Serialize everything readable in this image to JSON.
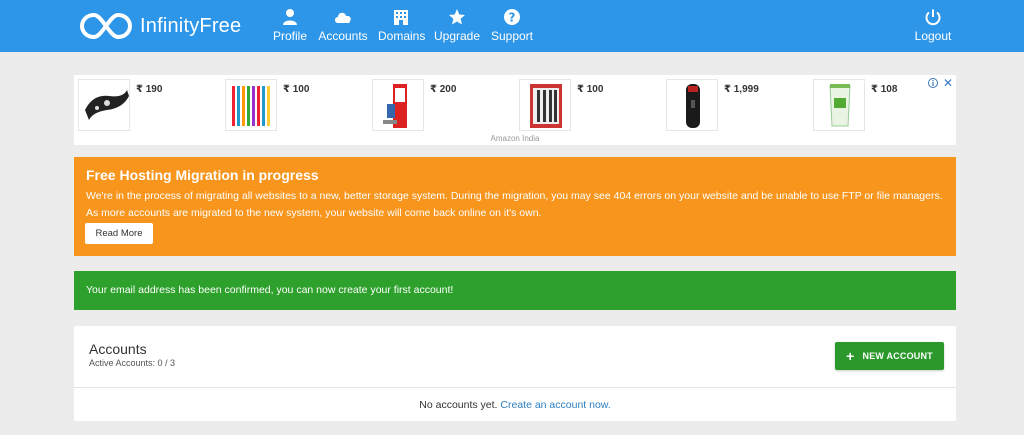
{
  "navbar": {
    "brand": "InfinityFree",
    "items": [
      {
        "label": "Profile",
        "icon": "user-icon"
      },
      {
        "label": "Accounts",
        "icon": "cloud-icon"
      },
      {
        "label": "Domains",
        "icon": "building-icon"
      },
      {
        "label": "Upgrade",
        "icon": "star-icon"
      },
      {
        "label": "Support",
        "icon": "help-icon"
      }
    ],
    "logout": {
      "label": "Logout",
      "icon": "power-icon"
    }
  },
  "ad": {
    "items": [
      {
        "price": "₹ 190",
        "product": "bike-helmet-strap"
      },
      {
        "price": "₹ 100",
        "product": "colored-pens"
      },
      {
        "price": "₹ 200",
        "product": "kids-pencil-set"
      },
      {
        "price": "₹ 100",
        "product": "pen-pack"
      },
      {
        "price": "₹ 1,999",
        "product": "beard-trimmer"
      },
      {
        "price": "₹ 108",
        "product": "face-wash-tube"
      }
    ],
    "source": "Amazon India",
    "close": "✕"
  },
  "migration_alert": {
    "title": "Free Hosting Migration in progress",
    "message": "We're in the process of migrating all websites to a new, better storage system. During the migration, you may see 404 errors on your website and be unable to use FTP or file managers. As more accounts are migrated to the new system, your website will come back online on it's own.",
    "button": "Read More"
  },
  "confirm_alert": {
    "message": "Your email address has been confirmed, you can now create your first account!"
  },
  "accounts": {
    "title": "Accounts",
    "subtitle": "Active Accounts: 0 / 3",
    "new_button": "NEW ACCOUNT",
    "empty_text": "No accounts yet.",
    "create_link": "Create an account now."
  },
  "colors": {
    "navbar": "#2d96e9",
    "warning": "#f7951d",
    "success": "#2ea02c",
    "link": "#2d7fc0"
  }
}
